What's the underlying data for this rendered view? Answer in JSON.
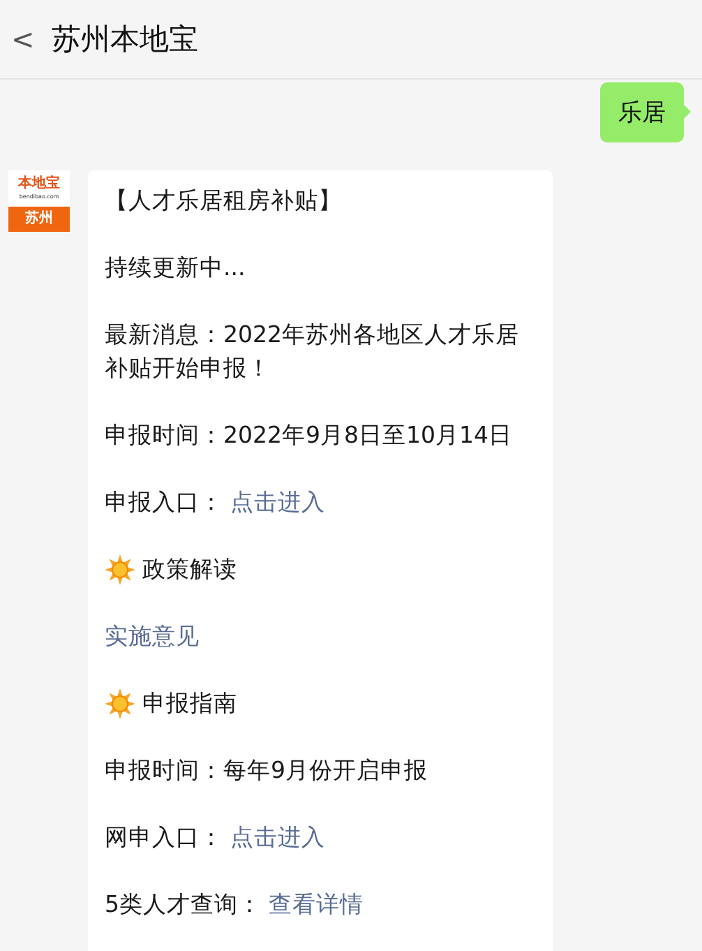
{
  "header": {
    "back": "<",
    "title": "苏州本地宝"
  },
  "messages": [
    {
      "kind": "sent",
      "text": "乐居"
    },
    {
      "kind": "received",
      "avatar": {
        "brand": "本地宝",
        "site": "bendibao.com",
        "city": "苏州"
      },
      "paragraphs": [
        {
          "kind": "text",
          "text": "【人才乐居租房补贴】"
        },
        {
          "kind": "text",
          "text": "持续更新中..."
        },
        {
          "kind": "text",
          "text": "最新消息：2022年苏州各地区人才乐居补贴开始申报！"
        },
        {
          "kind": "text",
          "text": "申报时间：2022年9月8日至10月14日"
        },
        {
          "kind": "label_link",
          "text": "申报入口：",
          "link": "点击进入"
        },
        {
          "kind": "heading",
          "text": "政策解读"
        },
        {
          "kind": "link",
          "link": "实施意见"
        },
        {
          "kind": "heading",
          "text": "申报指南"
        },
        {
          "kind": "text",
          "text": "申报时间：每年9月份开启申报"
        },
        {
          "kind": "label_link",
          "text": "网申入口：",
          "link": "点击进入"
        },
        {
          "kind": "label_link",
          "text": "5类人才查询：",
          "link": "查看详情"
        }
      ]
    }
  ]
}
